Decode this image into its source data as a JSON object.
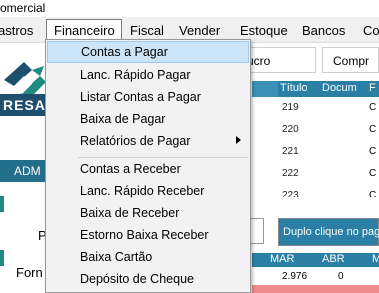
{
  "window": {
    "title": "omercial"
  },
  "menubar": {
    "items": [
      "astros",
      "Financeiro",
      "Fiscal",
      "Vender",
      "Estoque",
      "Bancos",
      "Co"
    ]
  },
  "left_panel": {
    "brand_text": "RESA",
    "adm_label": "ADM",
    "p_label": "P",
    "forn_label": "Forn"
  },
  "toolbar": {
    "input1_text": "ucro",
    "input2_text": "Compr"
  },
  "grid": {
    "headers": [
      "Título",
      "Docum",
      "F"
    ],
    "rows": [
      {
        "titulo": "219",
        "col3": "C"
      },
      {
        "titulo": "220",
        "col3": "C"
      },
      {
        "titulo": "221",
        "col3": "C"
      },
      {
        "titulo": "222",
        "col3": "C"
      },
      {
        "titulo": "223",
        "col3": "C"
      }
    ],
    "double_click_text": "Duplo clique no pag"
  },
  "bottom_grid": {
    "headers": [
      "MAR",
      "ABR",
      "M"
    ],
    "values": [
      "2.976",
      "0"
    ]
  },
  "dropdown": {
    "items": [
      {
        "label": "Contas a Pagar",
        "selected": true,
        "submenu": false
      },
      {
        "label": "Lanc. Rápido Pagar",
        "selected": false,
        "submenu": false
      },
      {
        "label": "Listar Contas a Pagar",
        "selected": false,
        "submenu": false
      },
      {
        "label": "Baixa de Pagar",
        "selected": false,
        "submenu": false
      },
      {
        "label": "Relatórios de Pagar",
        "selected": false,
        "submenu": true
      },
      {
        "label": "Contas a Receber",
        "selected": false,
        "submenu": false
      },
      {
        "label": "Lanc. Rápido Receber",
        "selected": false,
        "submenu": false
      },
      {
        "label": "Baixa de Receber",
        "selected": false,
        "submenu": false
      },
      {
        "label": "Estorno Baixa Receber",
        "selected": false,
        "submenu": false
      },
      {
        "label": "Baixa Cartão",
        "selected": false,
        "submenu": false
      },
      {
        "label": "Depósito de Cheque",
        "selected": false,
        "submenu": false
      }
    ]
  },
  "colors": {
    "accent": "#2a7fa4",
    "selection": "#cce4f7",
    "brand_teal": "#1f8a80",
    "brand_navy": "#1f4f6e"
  }
}
